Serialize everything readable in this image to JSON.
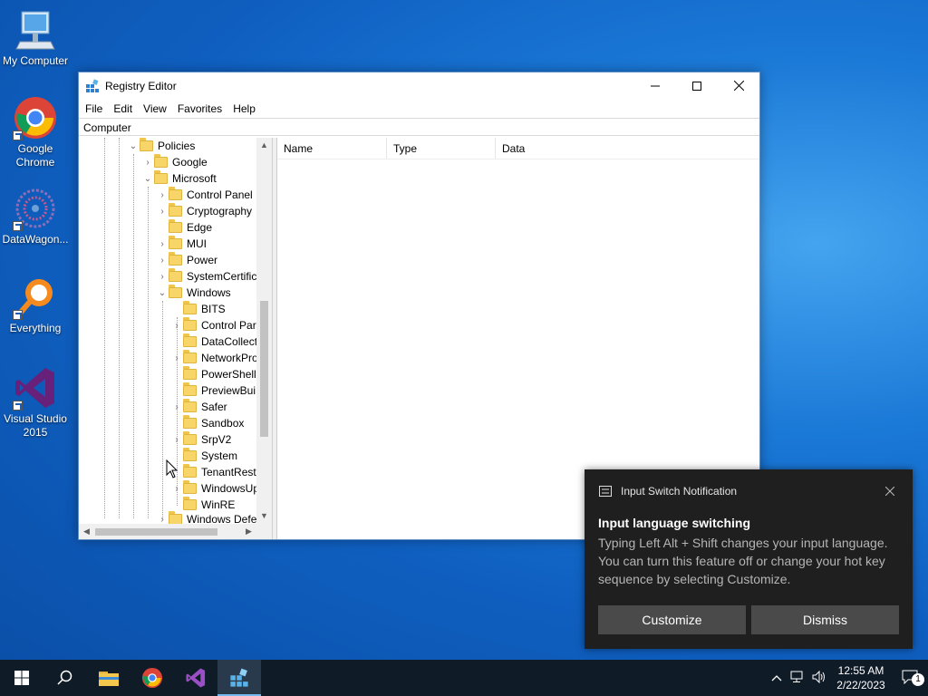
{
  "desktop": {
    "icons": [
      {
        "label": "My Computer"
      },
      {
        "label": "Google Chrome"
      },
      {
        "label": "DataWagon..."
      },
      {
        "label": "Everything"
      },
      {
        "label": "Visual Studio 2015"
      }
    ]
  },
  "window": {
    "title": "Registry Editor",
    "menu": [
      "File",
      "Edit",
      "View",
      "Favorites",
      "Help"
    ],
    "address": "Computer",
    "columns": [
      "Name",
      "Type",
      "Data"
    ],
    "tree": [
      {
        "label": "Policies",
        "expanded": true
      },
      {
        "label": "Google"
      },
      {
        "label": "Microsoft",
        "expanded": true
      },
      {
        "label": "Control Panel"
      },
      {
        "label": "Cryptography"
      },
      {
        "label": "Edge"
      },
      {
        "label": "MUI"
      },
      {
        "label": "Power"
      },
      {
        "label": "SystemCertific"
      },
      {
        "label": "Windows",
        "expanded": true
      },
      {
        "label": "BITS"
      },
      {
        "label": "Control Par"
      },
      {
        "label": "DataCollect"
      },
      {
        "label": "NetworkPro"
      },
      {
        "label": "PowerShell"
      },
      {
        "label": "PreviewBui"
      },
      {
        "label": "Safer"
      },
      {
        "label": "Sandbox"
      },
      {
        "label": "SrpV2"
      },
      {
        "label": "System"
      },
      {
        "label": "TenantRestr"
      },
      {
        "label": "WindowsUp"
      },
      {
        "label": "WinRE"
      },
      {
        "label": "Windows Defe"
      }
    ]
  },
  "notification": {
    "app": "Input Switch Notification",
    "heading": "Input language switching",
    "body": "Typing Left Alt + Shift changes your input language. You can turn this feature off or change your hot key sequence by selecting Customize.",
    "customize_label": "Customize",
    "dismiss_label": "Dismiss"
  },
  "taskbar": {
    "time": "12:55 AM",
    "date": "2/22/2023",
    "notification_count": "1"
  },
  "colors": {
    "accent": "#76b9ed",
    "taskbar": "#101b28",
    "toast": "#1f1f1f"
  }
}
